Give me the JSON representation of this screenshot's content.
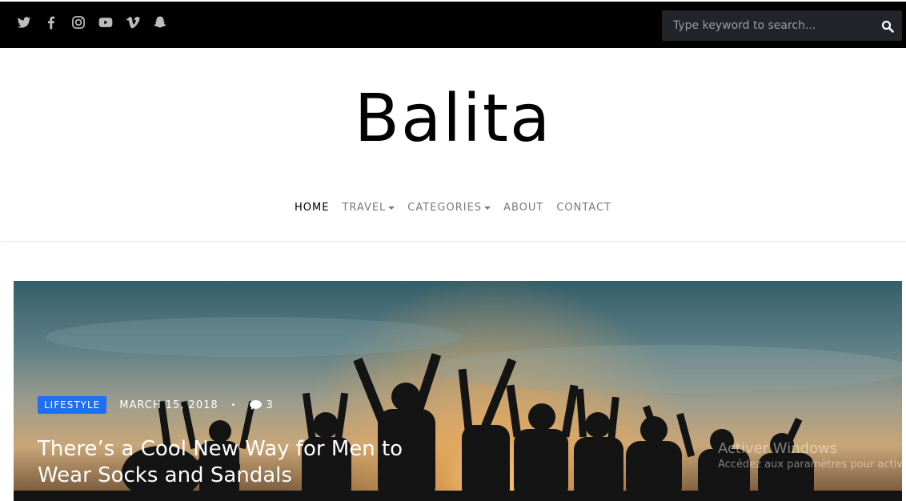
{
  "topbar": {
    "social_icons": [
      "twitter-icon",
      "facebook-icon",
      "instagram-icon",
      "youtube-icon",
      "vimeo-icon",
      "snapchat-icon"
    ],
    "search": {
      "placeholder": "Type keyword to search..."
    }
  },
  "site": {
    "title": "Balita"
  },
  "nav": {
    "items": [
      {
        "label": "HOME",
        "active": true
      },
      {
        "label": "TRAVEL",
        "dropdown": true
      },
      {
        "label": "CATEGORIES",
        "dropdown": true
      },
      {
        "label": "ABOUT"
      },
      {
        "label": "CONTACT"
      }
    ]
  },
  "hero": {
    "category": "LIFESTYLE",
    "date": "MARCH 15, 2018",
    "separator": "•",
    "comments": "3",
    "title_line1": "There’s a Cool New Way for Men to",
    "title_line2": "Wear Socks and Sandals"
  },
  "watermark": {
    "line1": "Activer Windows",
    "line2": "Accédez aux paramètres pour activer Windows."
  },
  "colors": {
    "topbar": "#000000",
    "badge": "#1e6ff2",
    "search_bg": "#212529"
  }
}
